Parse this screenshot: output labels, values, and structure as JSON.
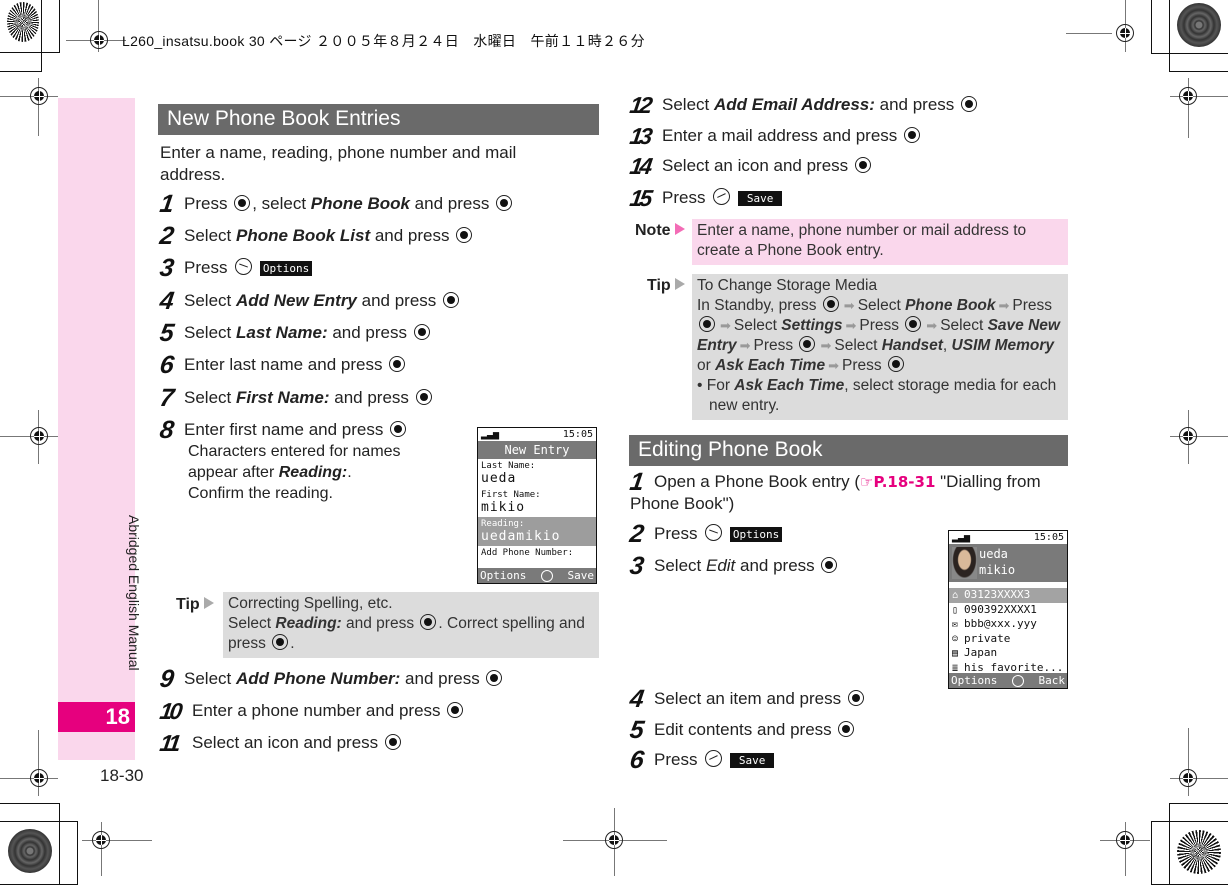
{
  "print_header": "L260_insatsu.book  30 ページ  ２００５年８月２４日　水曜日　午前１１時２６分",
  "sidebar": {
    "label": "Abridged English Manual",
    "chapter": "18",
    "page_number": "18-30"
  },
  "section1": {
    "title": "New Phone Book Entries",
    "intro": "Enter a name, reading, phone number and mail address.",
    "steps": [
      {
        "num": "1",
        "parts": [
          "Press ",
          "btn",
          ", select ",
          "i:Phone Book",
          " and press ",
          "btn"
        ]
      },
      {
        "num": "2",
        "parts": [
          "Select ",
          "i:Phone Book List",
          " and press ",
          "btn"
        ]
      },
      {
        "num": "3",
        "parts": [
          "Press ",
          "softL",
          " ",
          "key:Options"
        ]
      },
      {
        "num": "4",
        "parts": [
          "Select ",
          "i:Add New Entry",
          " and press ",
          "btn"
        ]
      },
      {
        "num": "5",
        "parts": [
          "Select ",
          "i:Last Name:",
          " and press ",
          "btn"
        ]
      },
      {
        "num": "6",
        "parts": [
          "Enter last name and press ",
          "btn"
        ]
      },
      {
        "num": "7",
        "parts": [
          "Select ",
          "i:First Name:",
          " and press ",
          "btn"
        ]
      },
      {
        "num": "8",
        "parts": [
          "Enter first name and press ",
          "btn"
        ]
      },
      {
        "num": "9",
        "parts": [
          "Select ",
          "i:Add Phone Number:",
          " and press ",
          "btn"
        ]
      },
      {
        "num": "10",
        "parts": [
          "Enter a phone number and press ",
          "btn"
        ]
      },
      {
        "num": "11",
        "parts": [
          "Select an icon and press ",
          "btn"
        ]
      },
      {
        "num": "12",
        "parts": [
          "Select ",
          "i:Add Email Address:",
          " and press ",
          "btn"
        ]
      },
      {
        "num": "13",
        "parts": [
          "Enter a mail address and press ",
          "btn"
        ]
      },
      {
        "num": "14",
        "parts": [
          "Select an icon and press ",
          "btn"
        ]
      },
      {
        "num": "15",
        "parts": [
          "Press ",
          "softR",
          " ",
          "key:Save"
        ]
      }
    ],
    "step8_sub": {
      "line1": "Characters entered for names",
      "line2_pre": "appear after ",
      "line2_em": "Reading:",
      "line2_post": ".",
      "line3": "Confirm the reading."
    },
    "tip": {
      "label": "Tip",
      "title": "Correcting Spelling, etc.",
      "text_pre": "Select ",
      "text_em": "Reading:",
      "text_mid": " and press ",
      "text_post": ". Correct spelling and press ",
      "text_end": "."
    },
    "note": {
      "label": "Note",
      "text": "Enter a name, phone number or mail address to create a Phone Book entry."
    },
    "tip2": {
      "label": "Tip",
      "title": "To Change Storage Media",
      "bullet_pre": "For ",
      "bullet_em": "Ask Each Time",
      "bullet_post": ", select storage media for each new entry."
    },
    "screen": {
      "time": "15:05",
      "title": "New Entry",
      "fields": [
        {
          "label": "Last Name:",
          "value": "ueda"
        },
        {
          "label": "First Name:",
          "value": "mikio"
        },
        {
          "label": "Reading:",
          "value": "uedamikio",
          "highlight": true
        },
        {
          "label": "Add Phone Number:",
          "value": ""
        }
      ],
      "soft_left": "Options",
      "soft_right": "Save"
    }
  },
  "section2": {
    "title": "Editing Phone Book",
    "step1": {
      "pre": "Open a Phone Book entry (",
      "link": "P.18-31",
      "post": " \"Dialling from Phone Book\")"
    },
    "steps": [
      {
        "num": "2",
        "parts": [
          "Press ",
          "softL",
          " ",
          "key:Options"
        ]
      },
      {
        "num": "3",
        "parts": [
          "Select ",
          "n:Edit",
          " and press ",
          "btn"
        ]
      },
      {
        "num": "4",
        "parts": [
          "Select an item and press ",
          "btn"
        ]
      },
      {
        "num": "5",
        "parts": [
          "Edit contents and press ",
          "btn"
        ]
      },
      {
        "num": "6",
        "parts": [
          "Press ",
          "softR",
          " ",
          "key:Save"
        ]
      }
    ],
    "screen": {
      "time": "15:05",
      "name_last": "ueda",
      "name_first": "mikio",
      "rows": [
        {
          "icon": "home-icon",
          "glyph": "⌂",
          "text": "03123XXXX3",
          "highlight": true
        },
        {
          "icon": "mobile-icon",
          "glyph": "▯",
          "text": "090392XXXX1"
        },
        {
          "icon": "mail-icon",
          "glyph": "✉",
          "text": "bbb@xxx.yyy"
        },
        {
          "icon": "group-icon",
          "glyph": "☺",
          "text": "private"
        },
        {
          "icon": "address-icon",
          "glyph": "▤",
          "text": "Japan"
        },
        {
          "icon": "memo-icon",
          "glyph": "≣",
          "text": "his favorite..."
        }
      ],
      "soft_left": "Options",
      "soft_right": "Back"
    }
  },
  "colors": {
    "accent": "#e6007e",
    "tab_bg": "#fad7ec",
    "header_bg": "#6a6a6a",
    "tip_bg": "#dcdcdc"
  }
}
